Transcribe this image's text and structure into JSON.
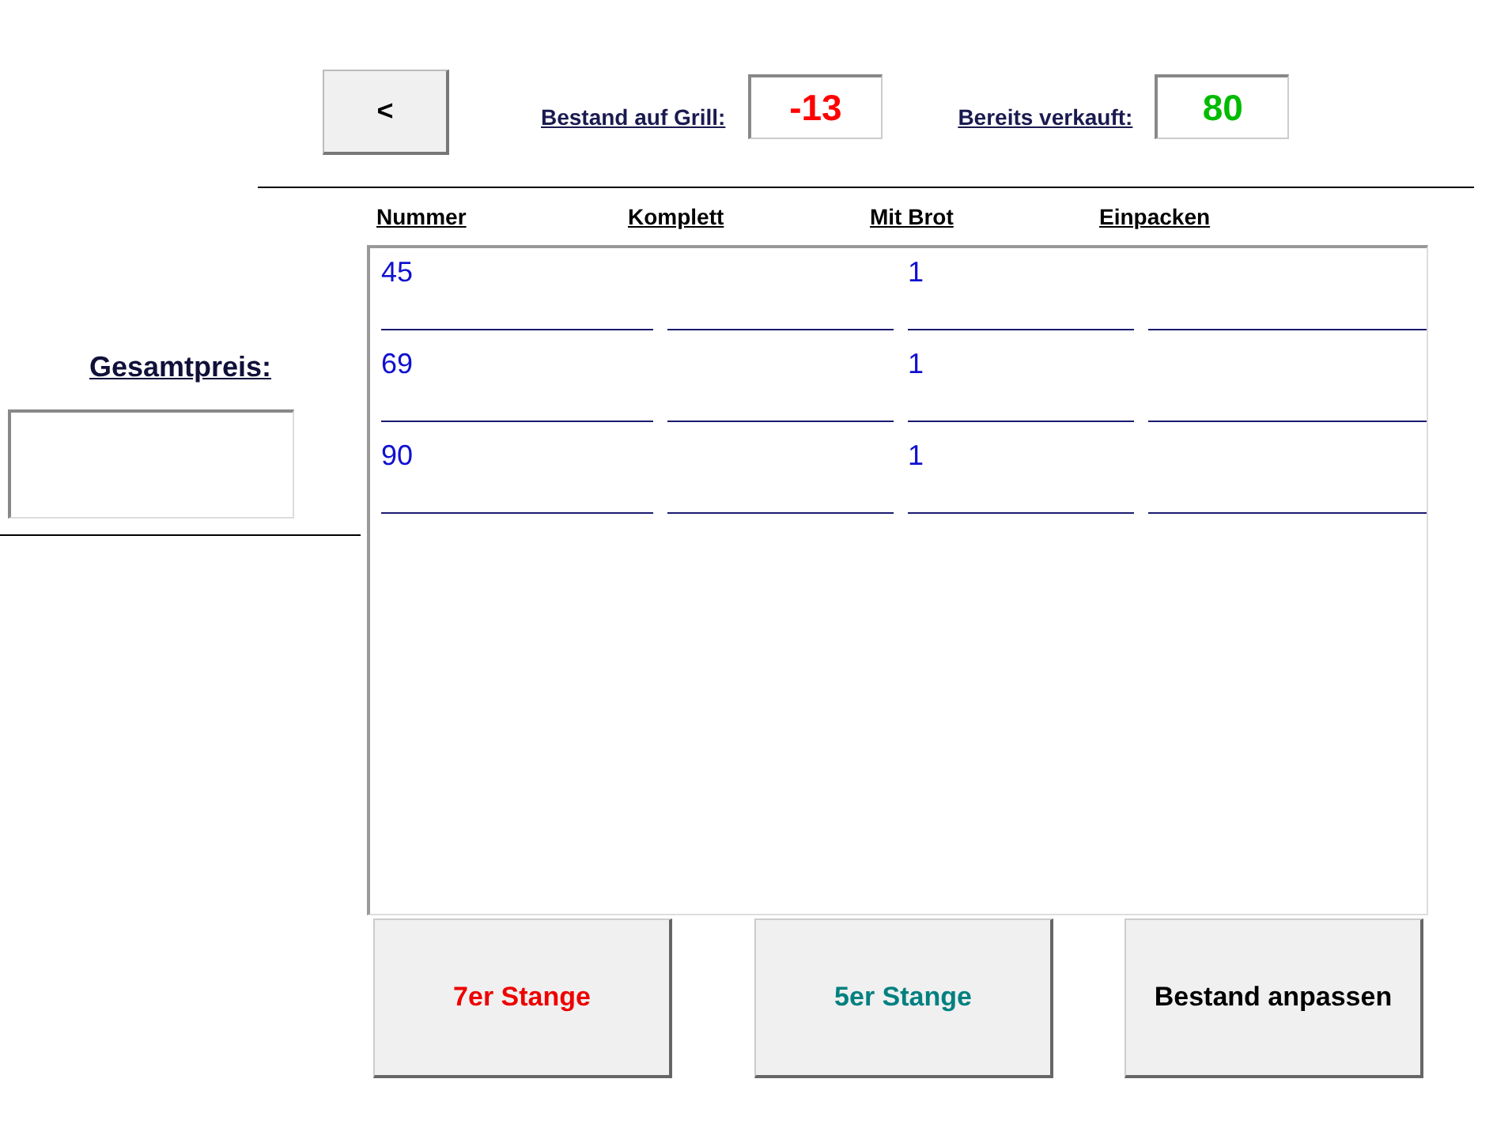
{
  "back_button": {
    "label": "<"
  },
  "stock_fields": [
    {
      "label": "Bestand auf Grill:",
      "value": "-13",
      "color": "#ff0000"
    },
    {
      "label": "Bereits verkauft:",
      "value": "80",
      "color": "#00bb00"
    }
  ],
  "list": {
    "columns": [
      "Nummer",
      "Komplett",
      "Mit Brot",
      "Einpacken"
    ],
    "rows": [
      {
        "cells": [
          "45",
          null,
          "1",
          null
        ]
      },
      {
        "cells": [
          "69",
          null,
          "1",
          null
        ]
      },
      {
        "cells": [
          "90",
          null,
          "1",
          null
        ]
      }
    ]
  },
  "total": {
    "label": "Gesamtpreis:"
  },
  "buttons": [
    {
      "label": "7er Stange",
      "color": "#ee0000"
    },
    {
      "label": "5er Stange",
      "color": "#008080"
    },
    {
      "label": "Bestand anpassen",
      "color": "#000000"
    }
  ]
}
